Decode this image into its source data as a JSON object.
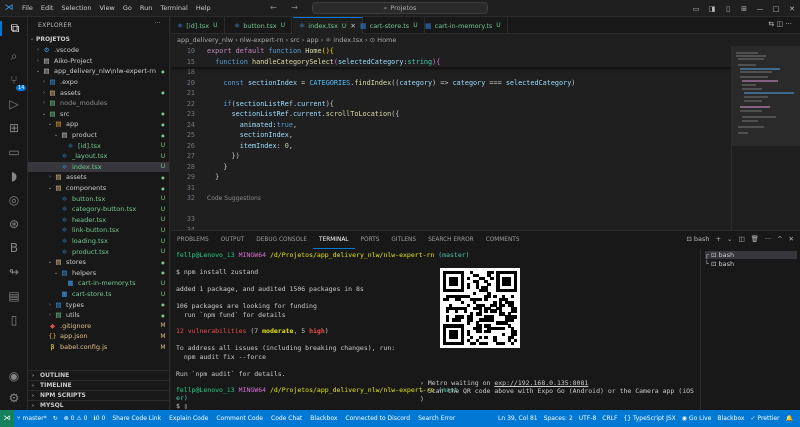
{
  "titlebar": {
    "menu": [
      "File",
      "Edit",
      "Selection",
      "View",
      "Go",
      "Run",
      "Terminal",
      "Help"
    ],
    "nav": "← →",
    "search": "Projetos",
    "controls": [
      "▭",
      "◨",
      "▯",
      "⊞",
      "—",
      "□",
      "✕"
    ]
  },
  "explorer": {
    "title": "EXPLORER",
    "more": "···",
    "root": "PROJETOS",
    "rows": [
      {
        "chev": "›",
        "icon": "⚙",
        "label": ".vscode",
        "status": "",
        "indent": 1,
        "icon_color": "#3e9be9"
      },
      {
        "chev": "›",
        "icon": "▤",
        "label": "Aiko-Project",
        "status": "",
        "indent": 1,
        "icon_color": "#cccccc"
      },
      {
        "chev": "⌄",
        "icon": "▤",
        "label": "app_delivery_nlw\\nlw-expert-rn",
        "status": "●",
        "indent": 1,
        "icon_color": "#cccccc",
        "status_color": "#73c991"
      },
      {
        "chev": "›",
        "icon": "▤",
        "label": ".expo",
        "status": "",
        "indent": 2,
        "icon_color": "#3e9be9"
      },
      {
        "chev": "›",
        "icon": "▤",
        "label": "assets",
        "status": "●",
        "indent": 2,
        "icon_color": "#e2c08d",
        "status_color": "#73c991"
      },
      {
        "chev": "›",
        "icon": "▤",
        "label": "node_modules",
        "status": "",
        "indent": 2,
        "icon_color": "#73c991",
        "dim": true
      },
      {
        "chev": "⌄",
        "icon": "▤",
        "label": "src",
        "status": "●",
        "indent": 2,
        "icon_color": "#73c991",
        "status_color": "#73c991"
      },
      {
        "chev": "⌄",
        "icon": "▤",
        "label": "app",
        "status": "●",
        "indent": 3,
        "icon_color": "#e8a33d",
        "status_color": "#73c991"
      },
      {
        "chev": "⌄",
        "icon": "▤",
        "label": "product",
        "status": "●",
        "indent": 4,
        "icon_color": "#cccccc",
        "status_color": "#73c991"
      },
      {
        "chev": "",
        "icon": "⚛",
        "label": "[id].tsx",
        "status": "U",
        "indent": 5,
        "icon_color": "#3e9be9",
        "status_color": "#73c991"
      },
      {
        "chev": "",
        "icon": "⚛",
        "label": "_layout.tsx",
        "status": "U",
        "indent": 4,
        "icon_color": "#3e9be9",
        "status_color": "#73c991"
      },
      {
        "chev": "",
        "icon": "⚛",
        "label": "index.tsx",
        "status": "U",
        "indent": 4,
        "icon_color": "#3e9be9",
        "status_color": "#73c991",
        "selected": true
      },
      {
        "chev": "›",
        "icon": "▤",
        "label": "assets",
        "status": "●",
        "indent": 3,
        "icon_color": "#e2c08d",
        "status_color": "#73c991"
      },
      {
        "chev": "⌄",
        "icon": "▤",
        "label": "components",
        "status": "●",
        "indent": 3,
        "icon_color": "#e2c08d",
        "status_color": "#73c991"
      },
      {
        "chev": "",
        "icon": "⚛",
        "label": "button.tsx",
        "status": "U",
        "indent": 4,
        "icon_color": "#3e9be9",
        "status_color": "#73c991"
      },
      {
        "chev": "",
        "icon": "⚛",
        "label": "category-button.tsx",
        "status": "U",
        "indent": 4,
        "icon_color": "#3e9be9",
        "status_color": "#73c991"
      },
      {
        "chev": "",
        "icon": "⚛",
        "label": "header.tsx",
        "status": "U",
        "indent": 4,
        "icon_color": "#3e9be9",
        "status_color": "#73c991"
      },
      {
        "chev": "",
        "icon": "⚛",
        "label": "link-button.tsx",
        "status": "U",
        "indent": 4,
        "icon_color": "#3e9be9",
        "status_color": "#73c991"
      },
      {
        "chev": "",
        "icon": "⚛",
        "label": "loading.tsx",
        "status": "U",
        "indent": 4,
        "icon_color": "#3e9be9",
        "status_color": "#73c991"
      },
      {
        "chev": "",
        "icon": "⚛",
        "label": "product.tsx",
        "status": "U",
        "indent": 4,
        "icon_color": "#3e9be9",
        "status_color": "#73c991"
      },
      {
        "chev": "⌄",
        "icon": "▤",
        "label": "stores",
        "status": "●",
        "indent": 3,
        "icon_color": "#e2c08d",
        "status_color": "#73c991"
      },
      {
        "chev": "⌄",
        "icon": "▤",
        "label": "helpers",
        "status": "●",
        "indent": 4,
        "icon_color": "#3e9be9",
        "status_color": "#73c991"
      },
      {
        "chev": "",
        "icon": "▦",
        "label": "cart-in-memory.ts",
        "status": "U",
        "indent": 5,
        "icon_color": "#3e9be9",
        "status_color": "#73c991"
      },
      {
        "chev": "",
        "icon": "▦",
        "label": "cart-store.ts",
        "status": "U",
        "indent": 4,
        "icon_color": "#3e9be9",
        "status_color": "#73c991"
      },
      {
        "chev": "›",
        "icon": "▤",
        "label": "types",
        "status": "●",
        "indent": 3,
        "icon_color": "#3e9be9",
        "status_color": "#73c991"
      },
      {
        "chev": "›",
        "icon": "▤",
        "label": "utils",
        "status": "●",
        "indent": 3,
        "icon_color": "#73c991",
        "status_color": "#73c991"
      },
      {
        "chev": "",
        "icon": "◆",
        "label": ".gitignore",
        "status": "M",
        "indent": 2,
        "icon_color": "#f14c4c",
        "status_color": "#e2c08d"
      },
      {
        "chev": "",
        "icon": "{}",
        "label": "app.json",
        "status": "M",
        "indent": 2,
        "icon_color": "#e8a33d",
        "status_color": "#e2c08d"
      },
      {
        "chev": "",
        "icon": "β",
        "label": "babel.config.js",
        "status": "M",
        "indent": 2,
        "icon_color": "#e5e510",
        "status_color": "#e2c08d"
      }
    ],
    "sections": [
      "OUTLINE",
      "TIMELINE",
      "NPM SCRIPTS",
      "MYSQL"
    ]
  },
  "tabs": [
    {
      "label": "[id].tsx",
      "status": "U",
      "active": false
    },
    {
      "label": "button.tsx",
      "status": "U",
      "active": false
    },
    {
      "label": "index.tsx",
      "status": "U",
      "active": true
    },
    {
      "label": "cart-store.ts",
      "status": "U",
      "active": false
    },
    {
      "label": "cart-in-memory.ts",
      "status": "U",
      "active": false
    }
  ],
  "tab_actions": "⇆ ◫ ···",
  "breadcrumb": "app_delivery_nlw › nlw-expert-rn › src › app › ⚛ index.tsx › ⊙ Home",
  "editor": {
    "sticky": [
      {
        "ln": "10",
        "text": "export default function Home(){"
      },
      {
        "ln": "15",
        "text": "  function handleCategorySelect(selectedCategory:string){"
      }
    ],
    "lines": [
      {
        "ln": "18",
        "text": ""
      },
      {
        "ln": "20",
        "text": "    const sectionIndex = CATEGORIES.findIndex((category) => category === selectedCategory)"
      },
      {
        "ln": "21",
        "text": ""
      },
      {
        "ln": "22",
        "text": "    if(sectionListRef.current){"
      },
      {
        "ln": "23",
        "text": "      sectionListRef.current.scrollToLocation({"
      },
      {
        "ln": "24",
        "text": "        animated:true,"
      },
      {
        "ln": "25",
        "text": "        sectionIndex,"
      },
      {
        "ln": "26",
        "text": "        itemIndex: 0,"
      },
      {
        "ln": "27",
        "text": "      })"
      },
      {
        "ln": "28",
        "text": "    }"
      },
      {
        "ln": "29",
        "text": "  }"
      },
      {
        "ln": "31",
        "text": ""
      },
      {
        "ln": "32",
        "text": ""
      },
      {
        "ln": "",
        "text": ""
      },
      {
        "ln": "33",
        "text": ""
      },
      {
        "ln": "34",
        "text": ""
      }
    ],
    "suggestion": "Code Suggestions"
  },
  "panel": {
    "tabs": [
      "PROBLEMS",
      "OUTPUT",
      "DEBUG CONSOLE",
      "TERMINAL",
      "PORTS",
      "GITLENS",
      "SEARCH ERROR",
      "COMMENTS"
    ],
    "active_tab": "TERMINAL",
    "actions": [
      "⊡ bash",
      "+",
      "⌄",
      "◫",
      "🗑",
      "···",
      "^",
      "✕"
    ],
    "terminals": [
      "bash",
      "bash"
    ]
  },
  "terminal": {
    "prompt_user": "fellp@Lenovo_i3",
    "prompt_env": "MINGW64",
    "prompt_path": "/d/Projetos/app_delivery_nlw/nlw-expert-rn",
    "branch": "(master)",
    "cmd1": "$ npm install zustand",
    "added": "added 1 package, and audited 1506 packages in 8s",
    "funding1": "106 packages are looking for funding",
    "funding2": "  run `npm fund` for details",
    "vuln_count": "12 vulnerabilities",
    "vuln_open": "(7 ",
    "vuln_moderate": "moderate",
    "vuln_sep": ", 5 ",
    "vuln_high": "high",
    "vuln_close": ")",
    "fix1": "To address all issues (including breaking changes), run:",
    "fix2": "  npm audit fix --force",
    "audit": "Run `npm audit` for details.",
    "prompt2_user": "fellp@Lenovo_i3",
    "prompt2_env": "MINGW64",
    "prompt2_path": "/d/Projetos/app_delivery_nlw/nlw-expert-rn",
    "prompt2_branch": "(mast",
    "prompt2_branch_wrap": "er)",
    "cursor": "$ ▯",
    "metro_prefix": "› Metro waiting on ",
    "metro_url": "exp://192.168.0.135:8081",
    "scan": "› Scan the QR code above with Expo Go (Android) or the Camera app (iOS",
    "scan_wrap": ")"
  },
  "statusbar": {
    "branch": "master*",
    "sync": "↻",
    "errors": "⊗ 0 ⚠ 0",
    "ports": "ℹ0 0",
    "items_left": [
      "Share Code Link",
      "Explain Code",
      "Comment Code",
      "Code Chat",
      "Blackbox",
      "Connected to Discord",
      "Search Error"
    ],
    "position": "Ln 39, Col 81",
    "spaces": "Spaces: 2",
    "encoding": "UTF-8",
    "eol": "CRLF",
    "lang": "{} TypeScript JSX",
    "golive": "Go Live",
    "blackbox": "Blackbox",
    "prettier": "✓ Prettier",
    "bell": "🔔"
  }
}
